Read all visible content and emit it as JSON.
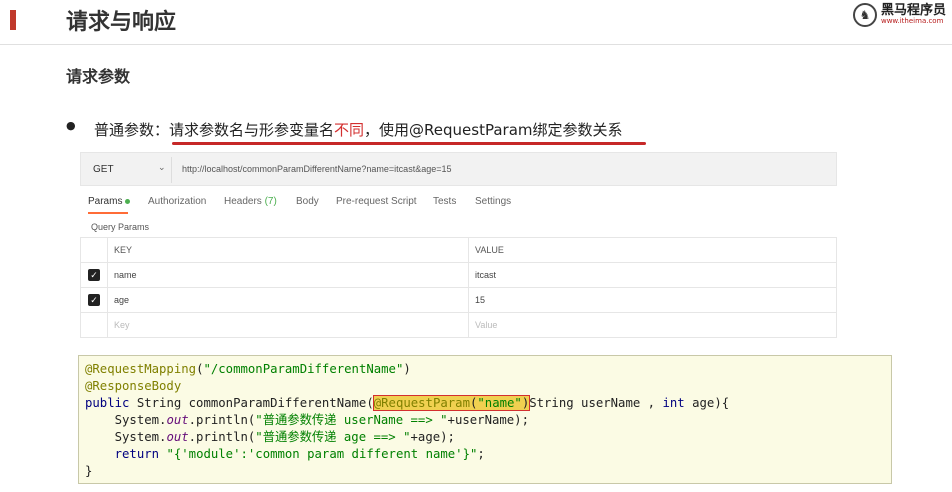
{
  "header": {
    "title": "请求与响应",
    "logo_cn": "黑马程序员",
    "logo_url": "www.itheima.com"
  },
  "section": {
    "subtitle": "请求参数",
    "bullet_label": "普通参数：",
    "bullet_text_a": "请求参数名与形参变量名",
    "bullet_text_red": "不同",
    "bullet_text_b": "，使用@RequestParam绑定参数关系"
  },
  "postman": {
    "method": "GET",
    "url": "http://localhost/commonParamDifferentName?name=itcast&age=15",
    "tabs": [
      {
        "label": "Params"
      },
      {
        "label": "Authorization"
      },
      {
        "label": "Headers",
        "count": "(7)"
      },
      {
        "label": "Body"
      },
      {
        "label": "Pre-request Script"
      },
      {
        "label": "Tests"
      },
      {
        "label": "Settings"
      }
    ],
    "query_params_label": "Query Params",
    "col_key": "KEY",
    "col_value": "VALUE",
    "rows": [
      {
        "key": "name",
        "value": "itcast",
        "checked": true
      },
      {
        "key": "age",
        "value": "15",
        "checked": true
      }
    ],
    "placeholder_key": "Key",
    "placeholder_value": "Value"
  },
  "code": {
    "l1_anno": "@RequestMapping",
    "l1_open": "(",
    "l1_str": "\"/commonParamDifferentName\"",
    "l1_close": ")",
    "l2_anno": "@ResponseBody",
    "l3_public": "public",
    "l3_a": " String commonParamDifferentName(",
    "l3_hl_anno": "@RequestParam",
    "l3_hl_open": "(",
    "l3_hl_str": "\"name\"",
    "l3_hl_close": ")",
    "l3_b": "String userName , ",
    "l3_int": "int",
    "l3_c": " age){",
    "l4_a": "    System.",
    "l4_out": "out",
    "l4_b": ".println(",
    "l4_str": "\"普通参数传递 userName ==> \"",
    "l4_c": "+userName);",
    "l5_a": "    System.",
    "l5_out": "out",
    "l5_b": ".println(",
    "l5_str": "\"普通参数传递 age ==> \"",
    "l5_c": "+age);",
    "l6_return": "    return",
    "l6_sp": " ",
    "l6_str": "\"{'module':'common param different name'}\"",
    "l6_c": ";",
    "l7": "}"
  }
}
